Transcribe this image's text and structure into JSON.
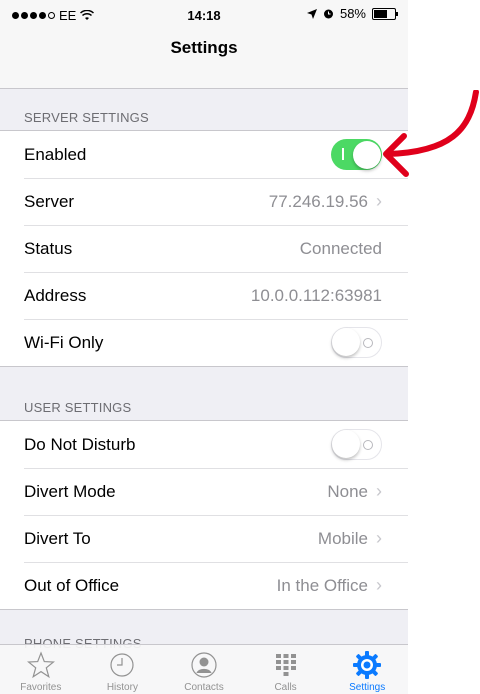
{
  "status_bar": {
    "carrier": "EE",
    "time": "14:18",
    "battery": "58%",
    "battery_level": 0.58
  },
  "nav": {
    "title": "Settings"
  },
  "server_settings": {
    "header": "SERVER SETTINGS",
    "enabled_label": "Enabled",
    "enabled_state": "on",
    "server_label": "Server",
    "server_value": "77.246.19.56",
    "status_label": "Status",
    "status_value": "Connected",
    "address_label": "Address",
    "address_value": "10.0.0.112:63981",
    "wifi_label": "Wi-Fi Only",
    "wifi_state": "off"
  },
  "user_settings": {
    "header": "USER SETTINGS",
    "dnd_label": "Do Not Disturb",
    "dnd_state": "off",
    "divert_mode_label": "Divert Mode",
    "divert_mode_value": "None",
    "divert_to_label": "Divert To",
    "divert_to_value": "Mobile",
    "ooo_label": "Out of Office",
    "ooo_value": "In the Office"
  },
  "phone_settings": {
    "header": "PHONE SETTINGS"
  },
  "tabs": [
    {
      "label": "Favorites",
      "icon": "star-icon"
    },
    {
      "label": "History",
      "icon": "clock-icon"
    },
    {
      "label": "Contacts",
      "icon": "contact-icon"
    },
    {
      "label": "Calls",
      "icon": "keypad-icon"
    },
    {
      "label": "Settings",
      "icon": "gear-icon"
    }
  ],
  "colors": {
    "toggle_on": "#4cd964",
    "tab_active": "#0a7aff",
    "annotation_arrow": "#e0001b"
  }
}
